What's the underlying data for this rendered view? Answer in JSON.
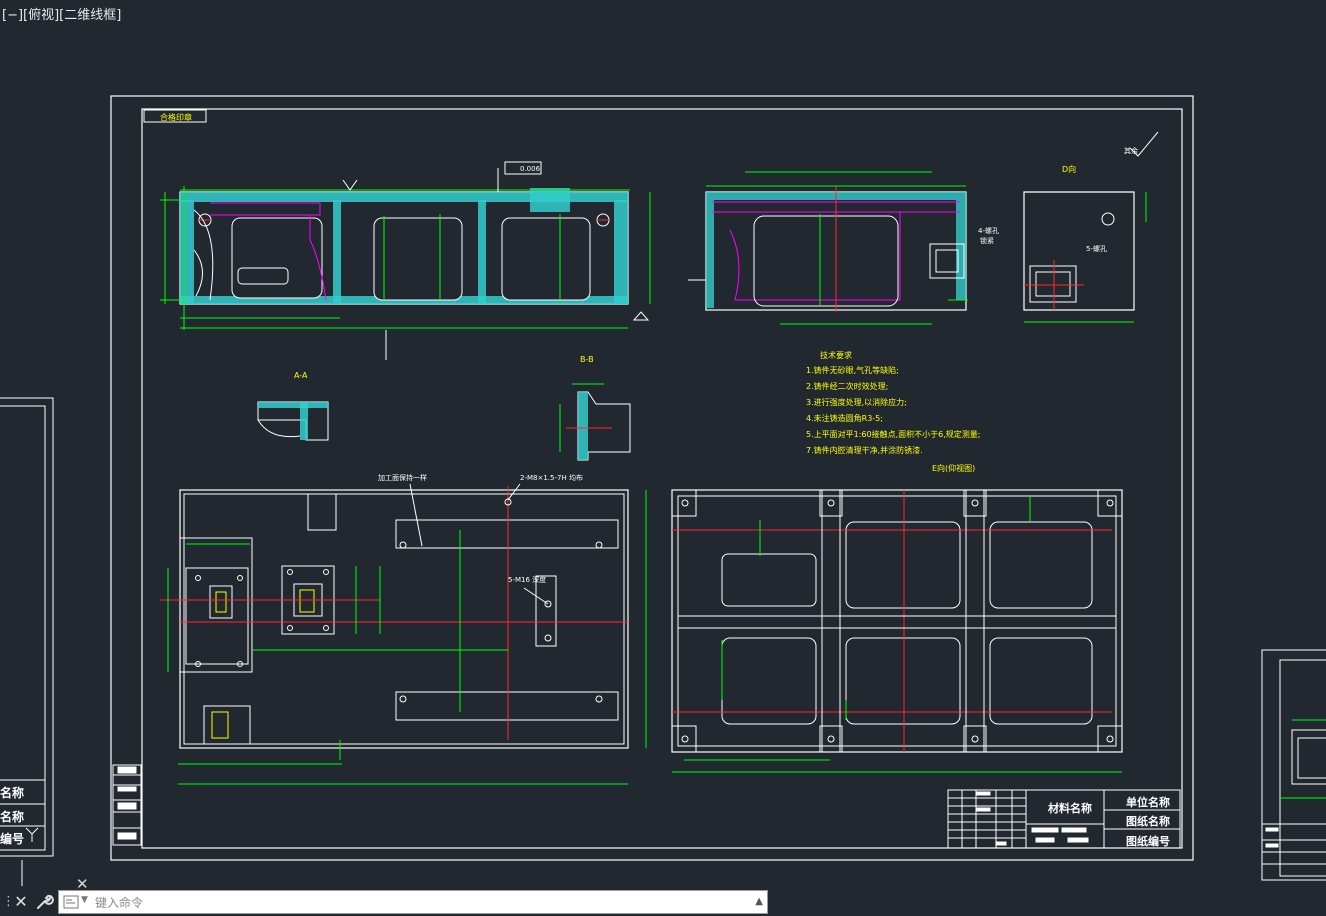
{
  "viewport": {
    "label": "[−][俯视][二维线框]"
  },
  "drawing": {
    "tech_title": "技术要求",
    "tech_notes": [
      "1.铸件无砂眼,气孔等缺陷;",
      "2.铸件经二次时效处理;",
      "3.进行强度处理,以消除应力;",
      "4.未注铸造圆角R3-5;",
      "5.上平面对平1:60接触点,面积不小于6,规定测量;",
      "7.铸件内腔清理干净,并涂防锈漆."
    ],
    "d_view_label": "D向",
    "section_label_a": "A-A",
    "section_label_b": "B-B",
    "bottom_view_label": "E向(仰视图)",
    "label_4holes": "4-螺孔",
    "label_side_text": "锁紧",
    "label_5holes": "5-螺孔",
    "label_note_a": "加工面保持一样",
    "label_note_b": "2-M8×1.5-7H 均布",
    "label_note_c": "5-M16 深度",
    "roughness": "其余",
    "flatness_value": "0.006",
    "top_tag": "合格印章"
  },
  "title_block": {
    "material": "材料名称",
    "unit": "单位名称",
    "drawing_name": "图纸名称",
    "drawing_number": "图纸编号"
  },
  "left_sheet": {
    "row1": "名称",
    "row2": "名称",
    "row3": "编号"
  },
  "command_line": {
    "placeholder": "键入命令"
  },
  "colors": {
    "background": "#212830",
    "frame": "#ffffff",
    "dimension": "#00ff00",
    "section_fill": "#33cccc",
    "center_line": "#ff2a2a",
    "hidden_line": "#ff00ff",
    "text": "#ffff00"
  },
  "icons": [
    "close-icon",
    "wrench-icon",
    "command-icon",
    "grip-icon",
    "arrow-up-icon"
  ]
}
